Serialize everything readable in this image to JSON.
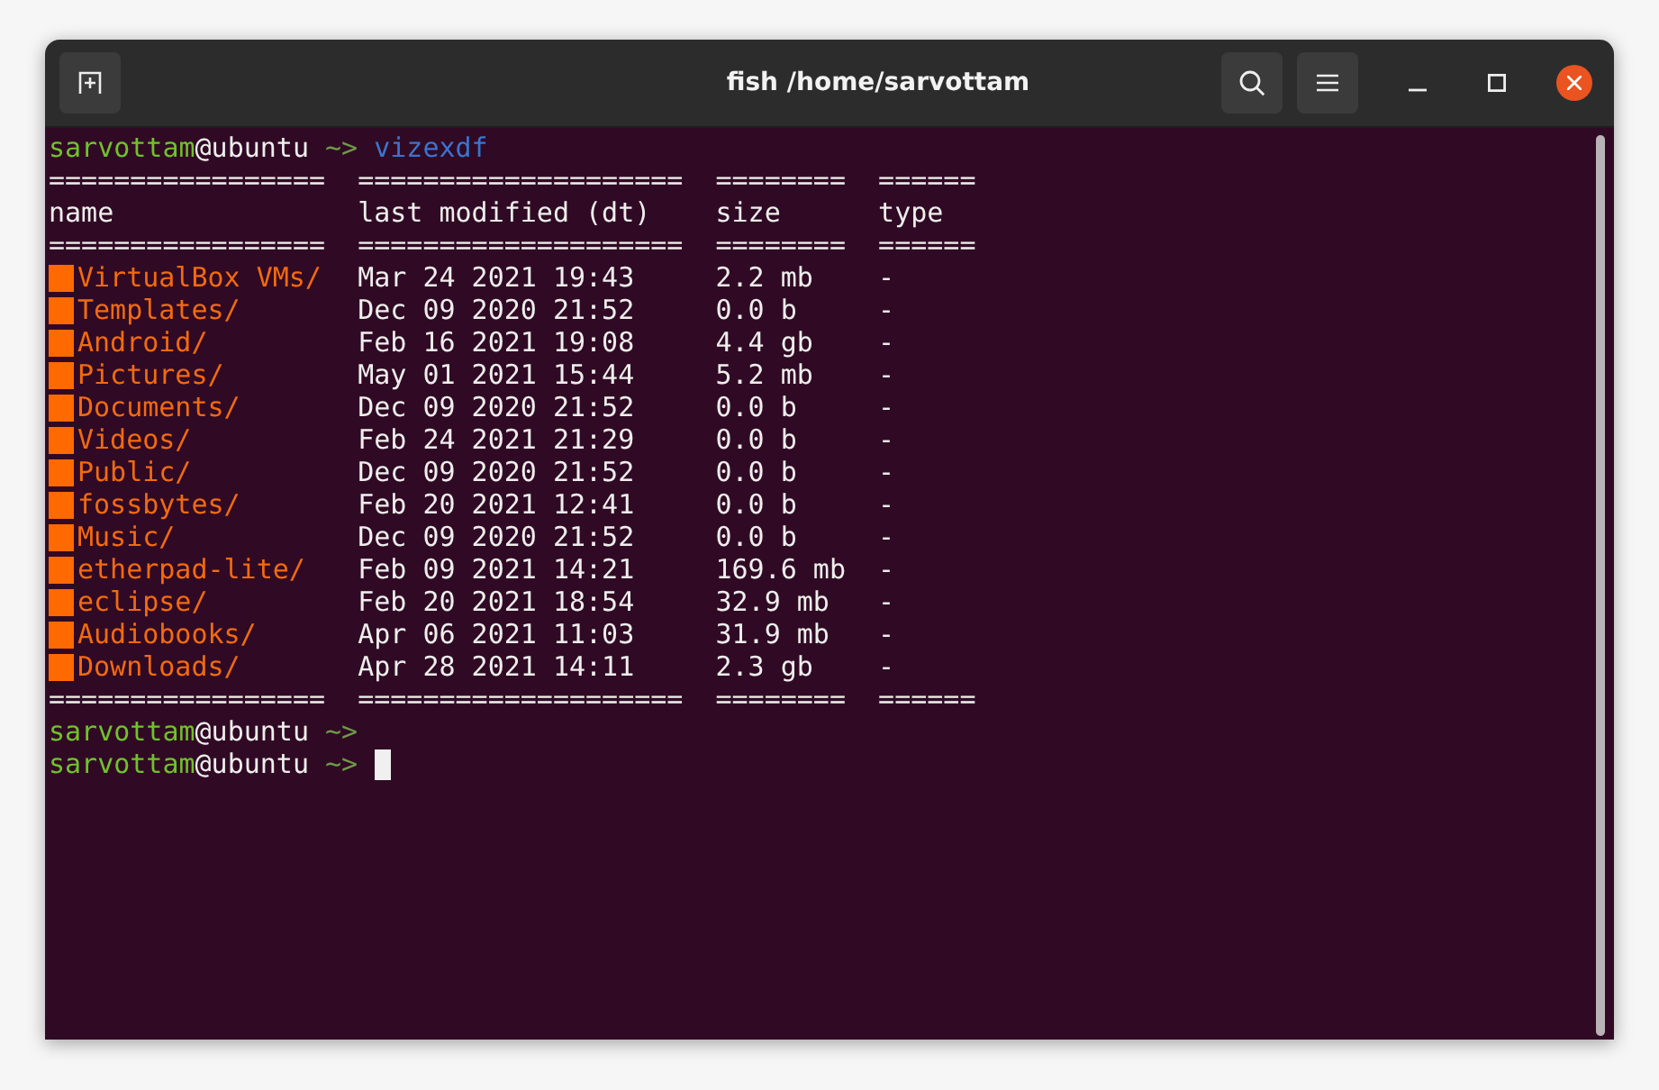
{
  "window": {
    "title": "fish /home/sarvottam"
  },
  "session": {
    "command_prompt": {
      "user": "sarvottam",
      "host": "@ubuntu",
      "symbol": "~>",
      "command": "vizexdf"
    },
    "separator": [
      "=================",
      "====================",
      "========",
      "======"
    ],
    "columns": [
      "name",
      "last modified (dt)",
      "size",
      "type"
    ],
    "rows": [
      {
        "name": "VirtualBox VMs/",
        "modified": "Mar 24 2021 19:43",
        "size": "2.2 mb",
        "type": "-"
      },
      {
        "name": "Templates/",
        "modified": "Dec 09 2020 21:52",
        "size": "0.0 b",
        "type": "-"
      },
      {
        "name": "Android/",
        "modified": "Feb 16 2021 19:08",
        "size": "4.4 gb",
        "type": "-"
      },
      {
        "name": "Pictures/",
        "modified": "May 01 2021 15:44",
        "size": "5.2 mb",
        "type": "-"
      },
      {
        "name": "Documents/",
        "modified": "Dec 09 2020 21:52",
        "size": "0.0 b",
        "type": "-"
      },
      {
        "name": "Videos/",
        "modified": "Feb 24 2021 21:29",
        "size": "0.0 b",
        "type": "-"
      },
      {
        "name": "Public/",
        "modified": "Dec 09 2020 21:52",
        "size": "0.0 b",
        "type": "-"
      },
      {
        "name": "fossbytes/",
        "modified": "Feb 20 2021 12:41",
        "size": "0.0 b",
        "type": "-"
      },
      {
        "name": "Music/",
        "modified": "Dec 09 2020 21:52",
        "size": "0.0 b",
        "type": "-"
      },
      {
        "name": "etherpad-lite/",
        "modified": "Feb 09 2021 14:21",
        "size": "169.6 mb",
        "type": "-"
      },
      {
        "name": "eclipse/",
        "modified": "Feb 20 2021 18:54",
        "size": "32.9 mb",
        "type": "-"
      },
      {
        "name": "Audiobooks/",
        "modified": "Apr 06 2021 11:03",
        "size": "31.9 mb",
        "type": "-"
      },
      {
        "name": "Downloads/",
        "modified": "Apr 28 2021 14:11",
        "size": "2.3 gb",
        "type": "-"
      }
    ],
    "closing_separator": [
      "=================",
      "====================",
      "========",
      "======"
    ],
    "prompts": [
      {
        "user": "sarvottam",
        "host": "@ubuntu",
        "symbol": "~>",
        "cursor": false
      },
      {
        "user": "sarvottam",
        "host": "@ubuntu",
        "symbol": "~>",
        "cursor": true
      }
    ]
  }
}
